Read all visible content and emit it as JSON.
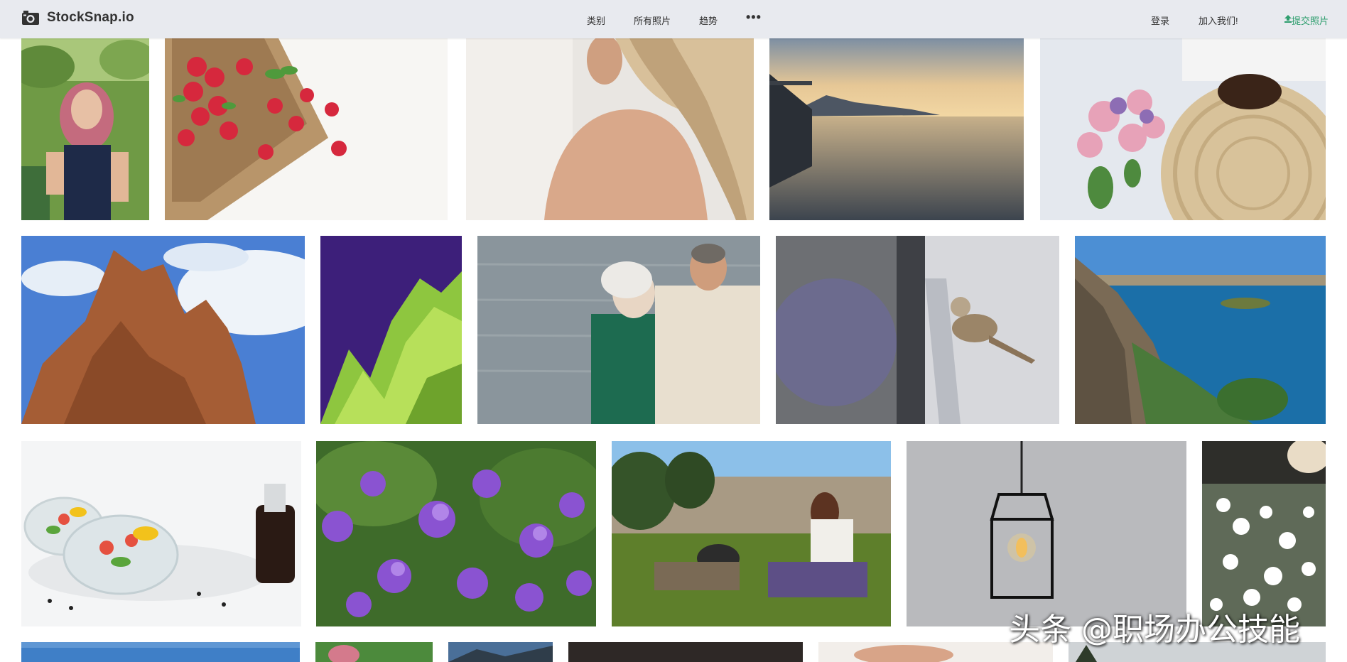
{
  "header": {
    "logo_text": "StockSnap.io",
    "nav": {
      "categories": "类别",
      "all_photos": "所有照片",
      "trending": "趋势",
      "more": "•••"
    },
    "login": "登录",
    "join": "加入我们!",
    "submit": "提交照片"
  },
  "gallery": {
    "photos": [
      {
        "name": "photo-woman-park",
        "icon": "portrait"
      },
      {
        "name": "photo-raspberries-burlap",
        "icon": "fruit"
      },
      {
        "name": "photo-blonde-hair-back",
        "icon": "portrait"
      },
      {
        "name": "photo-sunset-pier-lake",
        "icon": "landscape"
      },
      {
        "name": "photo-straw-bag-roses",
        "icon": "flowers"
      },
      {
        "name": "photo-red-rock-sky",
        "icon": "landscape"
      },
      {
        "name": "photo-green-plant-purple",
        "icon": "plant"
      },
      {
        "name": "photo-elderly-couple-sea",
        "icon": "people"
      },
      {
        "name": "photo-sparrow-railing",
        "icon": "bird"
      },
      {
        "name": "photo-coastal-cliffs",
        "icon": "landscape"
      },
      {
        "name": "photo-salad-bowls",
        "icon": "food"
      },
      {
        "name": "photo-purple-flowers",
        "icon": "flowers"
      },
      {
        "name": "photo-couple-lawn-camera",
        "icon": "people"
      },
      {
        "name": "photo-hanging-lantern",
        "icon": "lamp"
      },
      {
        "name": "photo-white-blossoms",
        "icon": "flowers"
      },
      {
        "name": "photo-row4-a",
        "icon": "landscape"
      },
      {
        "name": "photo-row4-b",
        "icon": "people"
      },
      {
        "name": "photo-row4-c",
        "icon": "landscape"
      },
      {
        "name": "photo-row4-d",
        "icon": "dark"
      },
      {
        "name": "photo-row4-e",
        "icon": "people"
      },
      {
        "name": "photo-row4-f",
        "icon": "landscape"
      }
    ]
  },
  "watermark": "头条 @职场办公技能",
  "colors": {
    "accent_green": "#2e9e6e",
    "header_bg": "#e8eaef"
  }
}
